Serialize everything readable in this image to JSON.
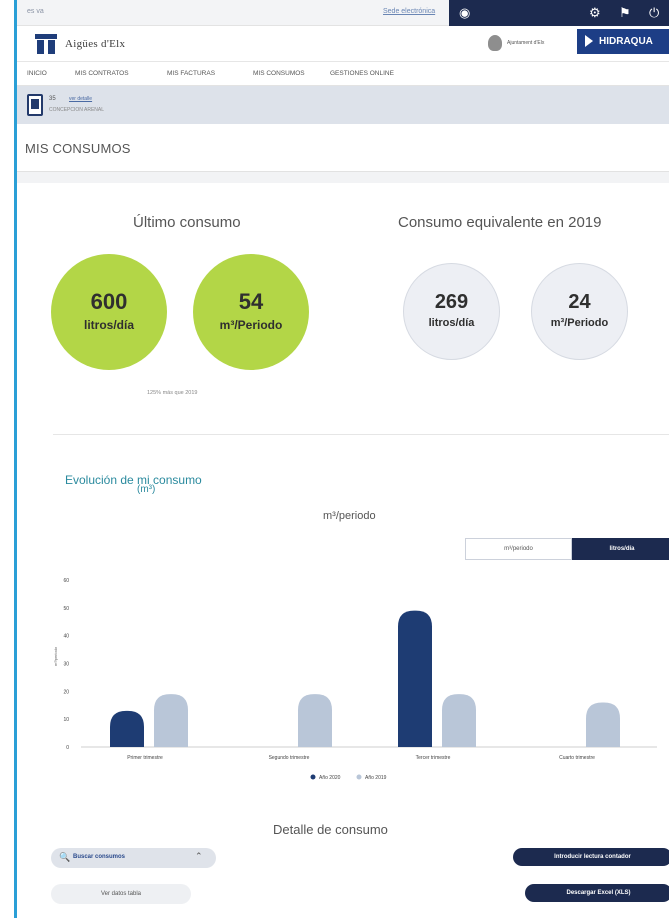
{
  "topbar": {
    "lang": "es  va",
    "sede": "Sede electrónica",
    "icons": [
      "user-circle-icon",
      "gear-icon",
      "notification-icon",
      "power-icon"
    ]
  },
  "brand": {
    "name": "Aigües d'Elx",
    "ajuntament": "Ajuntament d'Elx",
    "hidraqua": "HIDRAQUA"
  },
  "nav": [
    "INICIO",
    "MIS CONTRATOS",
    "MIS FACTURAS",
    "MIS CONSUMOS",
    "GESTIONES ONLINE"
  ],
  "contract": {
    "number": "35",
    "link": "ver detalle",
    "address": "CONCEPCION ARENAL"
  },
  "section_title": "MIS CONSUMOS",
  "ultimo": {
    "heading": "Último consumo",
    "daily_value": "600",
    "daily_unit": "litros/día",
    "period_value": "54",
    "period_unit": "m³/Periodo",
    "note": "125% más que 2019"
  },
  "equivalente": {
    "heading": "Consumo equivalente en 2019",
    "daily_value": "269",
    "daily_unit": "litros/día",
    "period_value": "24",
    "period_unit": "m³/Periodo"
  },
  "evolucion": {
    "title_1": "Evolución de mi consumo",
    "title_2": "(m³)",
    "subtitle": "m³/periodo",
    "toggle_periodo": "m³/periodo",
    "toggle_dia": "litros/día"
  },
  "chart_data": {
    "type": "bar",
    "title": "m³/periodo",
    "ylabel": "m³/periodo",
    "ylim": [
      0,
      60
    ],
    "yticks": [
      0,
      10,
      20,
      30,
      40,
      50,
      60
    ],
    "categories": [
      "Primer trimestre",
      "Segundo trimestre",
      "Tercer trimestre",
      "Cuarto trimestre"
    ],
    "series": [
      {
        "name": "Año 2020",
        "color": "#1e3c73",
        "values": [
          13,
          null,
          49,
          null
        ]
      },
      {
        "name": "Año 2019",
        "color": "#b9c6d8",
        "values": [
          19,
          19,
          19,
          16
        ]
      }
    ],
    "legend_position": "bottom",
    "grid": false
  },
  "detalle": {
    "title": "Detalle de consumo",
    "search": "Buscar consumos",
    "ver_tabla": "Ver datos tabla",
    "introducir": "Introducir lectura contador",
    "descargar": "Descargar Excel (XLS)"
  }
}
